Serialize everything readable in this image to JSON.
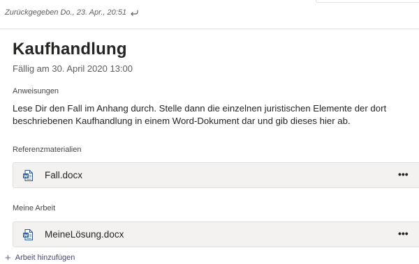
{
  "header": {
    "returned_text": "Zurückgegeben Do., 23. Apr., 20:51"
  },
  "assignment": {
    "title": "Kaufhandlung",
    "due": "Fällig am 30. April 2020 13:00",
    "instructions_label": "Anweisungen",
    "instructions_text": "Lese Dir den Fall im Anhang durch. Stelle dann die einzelnen juristischen Elemente der dort beschriebenen Kaufhandlung in einem Word-Dokument dar und gib dieses hier ab."
  },
  "reference": {
    "label": "Referenzmaterialien",
    "file_name": "Fall.docx",
    "more": "•••"
  },
  "my_work": {
    "label": "Meine Arbeit",
    "file_name": "MeineLösung.docx",
    "more": "•••",
    "add_label": "Arbeit hinzufügen",
    "add_icon": "+"
  },
  "colors": {
    "accent": "#6264a7",
    "word_blue": "#2b579a"
  },
  "icons": {
    "returned": "undo-arrow-icon",
    "file": "word-document-icon",
    "more": "more-options-icon",
    "add": "plus-icon"
  }
}
